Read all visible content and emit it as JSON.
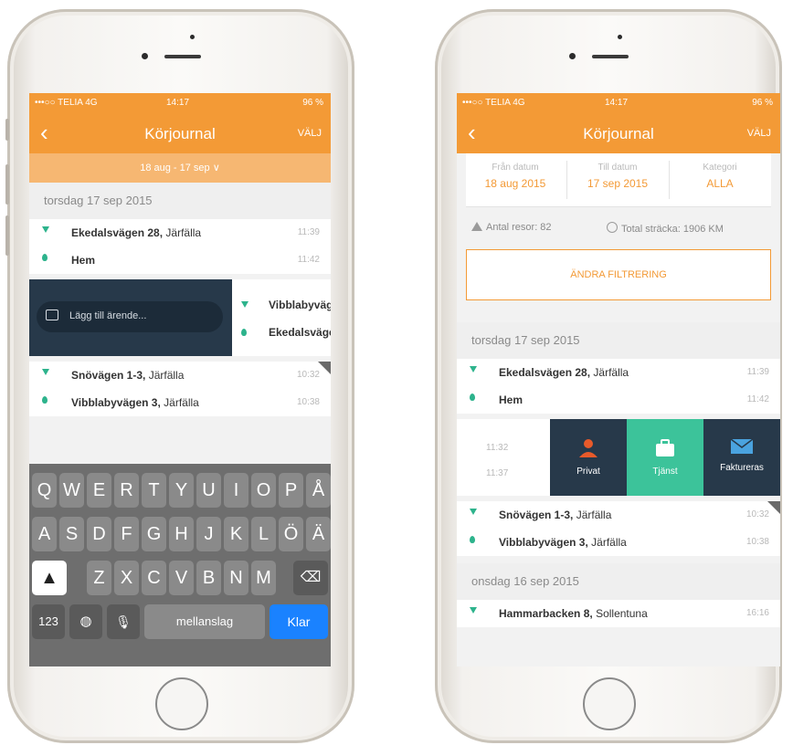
{
  "left_phone": {
    "status": {
      "carrier": "•••○○ TELIA 4G",
      "time": "14:17",
      "battery": "96 %"
    },
    "nav": {
      "back": "‹",
      "title": "Körjournal",
      "right": "VÄLJ"
    },
    "date_range": "18 aug - 17 sep ∨",
    "day_header": "torsdag 17 sep 2015",
    "rows_top": [
      {
        "address_bold": "Ekedalsvägen 28,",
        "address_rest": " Järfälla",
        "time": "11:39"
      },
      {
        "address_bold": "Hem",
        "address_rest": "",
        "time": "11:42"
      }
    ],
    "comment_placeholder": "Lägg till ärende...",
    "swipe_rows": [
      {
        "address_bold": "Vibblabyväg"
      },
      {
        "address_bold": "Ekedalsväge"
      }
    ],
    "rows_bottom": [
      {
        "address_bold": "Snövägen 1-3,",
        "address_rest": " Järfälla",
        "time": "10:32"
      },
      {
        "address_bold": "Vibblabyvägen 3,",
        "address_rest": " Järfälla",
        "time": "10:38"
      }
    ],
    "keyboard": {
      "row1": [
        "Q",
        "W",
        "E",
        "R",
        "T",
        "Y",
        "U",
        "I",
        "O",
        "P",
        "Å"
      ],
      "row2": [
        "A",
        "S",
        "D",
        "F",
        "G",
        "H",
        "J",
        "K",
        "L",
        "Ö",
        "Ä"
      ],
      "row3": [
        "Z",
        "X",
        "C",
        "V",
        "B",
        "N",
        "M"
      ],
      "numbers": "123",
      "space": "mellanslag",
      "done": "Klar"
    }
  },
  "right_phone": {
    "status": {
      "carrier": "•••○○ TELIA 4G",
      "time": "14:17",
      "battery": "96 %"
    },
    "nav": {
      "back": "‹",
      "title": "Körjournal",
      "right": "VÄLJ"
    },
    "filters": [
      {
        "label": "Från datum",
        "value": "18 aug 2015"
      },
      {
        "label": "Till datum",
        "value": "17 sep 2015"
      },
      {
        "label": "Kategori",
        "value": "ALLA"
      }
    ],
    "stats": {
      "trips": "Antal resor: 82",
      "distance": "Total sträcka: 1906 KM"
    },
    "filter_button": "ÄNDRA FILTRERING",
    "day_header_1": "torsdag 17 sep 2015",
    "rows_top": [
      {
        "address_bold": "Ekedalsvägen 28,",
        "address_rest": " Järfälla",
        "time": "11:39"
      },
      {
        "address_bold": "Hem",
        "address_rest": "",
        "time": "11:42"
      }
    ],
    "swipe_times": [
      "11:32",
      "11:37"
    ],
    "actions": [
      {
        "label": "Privat",
        "color": "#27394a",
        "icon": "person-icon"
      },
      {
        "label": "Tjänst",
        "color": "#3cc39a",
        "icon": "briefcase-icon"
      },
      {
        "label": "Faktureras",
        "color": "#27394a",
        "icon": "envelope-icon"
      }
    ],
    "rows_bottom": [
      {
        "address_bold": "Snövägen 1-3,",
        "address_rest": " Järfälla",
        "time": "10:32"
      },
      {
        "address_bold": "Vibblabyvägen 3,",
        "address_rest": " Järfälla",
        "time": "10:38"
      }
    ],
    "day_header_2": "onsdag 16 sep 2015",
    "rows_last": [
      {
        "address_bold": "Hammarbacken 8,",
        "address_rest": " Sollentuna",
        "time": "16:16"
      }
    ]
  },
  "colors": {
    "accent": "#f39a36",
    "green": "#2db38c",
    "dark": "#27394a",
    "keyboard_done": "#1a82ff"
  }
}
